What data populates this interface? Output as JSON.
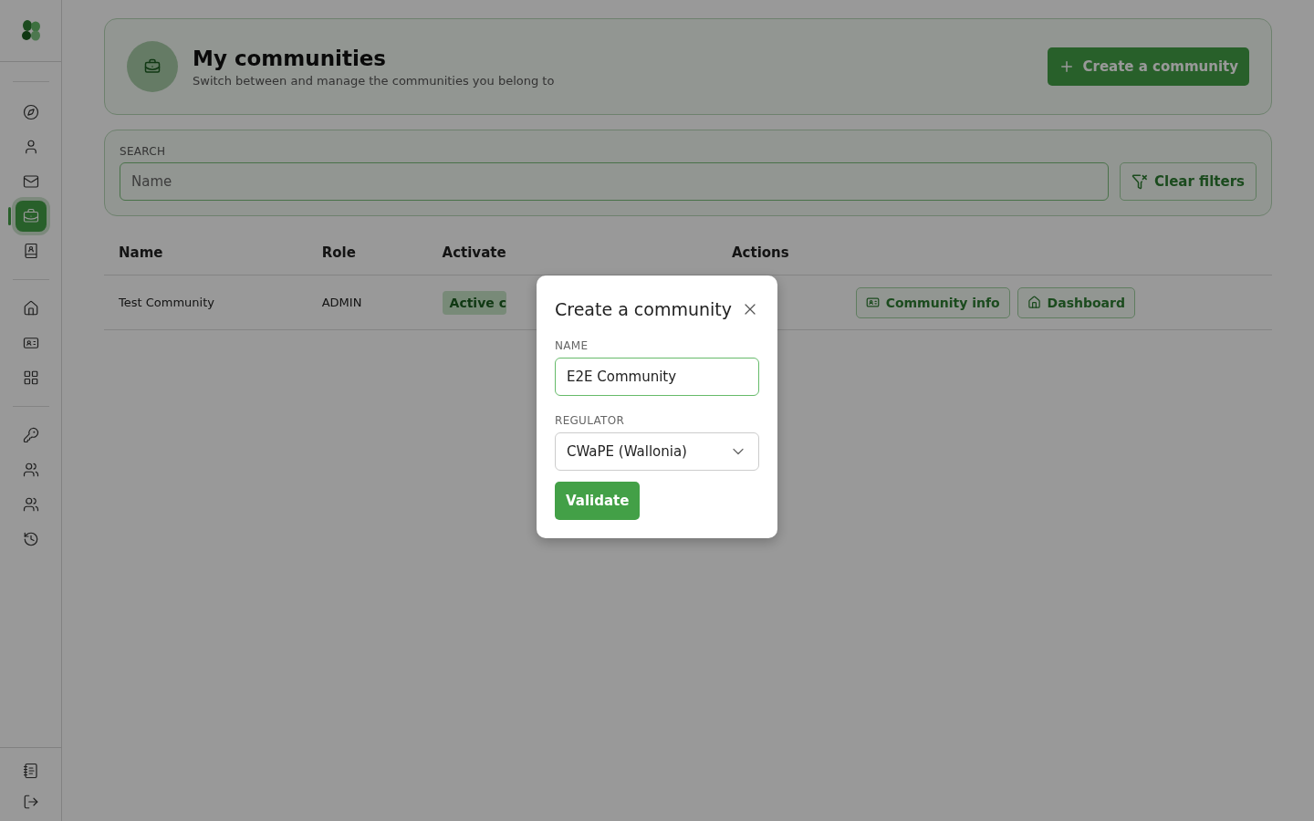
{
  "sidebar": {
    "groups": [
      {
        "items": [
          {
            "selected": false
          },
          {
            "selected": false
          },
          {
            "selected": false
          },
          {
            "selected": true
          },
          {
            "selected": false
          }
        ]
      },
      {
        "items": [
          {
            "selected": false
          },
          {
            "selected": false
          },
          {
            "selected": false
          }
        ]
      },
      {
        "items": [
          {
            "selected": false
          },
          {
            "selected": false
          },
          {
            "selected": false
          },
          {
            "selected": false
          }
        ]
      }
    ],
    "footer_items": [
      {
        "selected": false
      },
      {
        "selected": false
      }
    ]
  },
  "header": {
    "title": "My communities",
    "subtitle": "Switch between and manage the communities you belong to",
    "create_button": "Create a community"
  },
  "search": {
    "label": "SEARCH",
    "placeholder": "Name",
    "clear_button": "Clear filters"
  },
  "table": {
    "columns": [
      "Name",
      "Role",
      "Activate",
      "Actions"
    ],
    "rows": [
      {
        "name": "Test Community",
        "role": "ADMIN",
        "status": "Active c",
        "actions": [
          "Community info",
          "Dashboard"
        ]
      }
    ]
  },
  "dialog": {
    "title": "Create a community",
    "fields": [
      {
        "kind": "text",
        "label": "NAME",
        "value": "E2E Community",
        "focused": true
      },
      {
        "kind": "select",
        "label": "REGULATOR",
        "value": "CWaPE (Wallonia)",
        "focused": false
      }
    ],
    "submit_button": "Validate"
  }
}
